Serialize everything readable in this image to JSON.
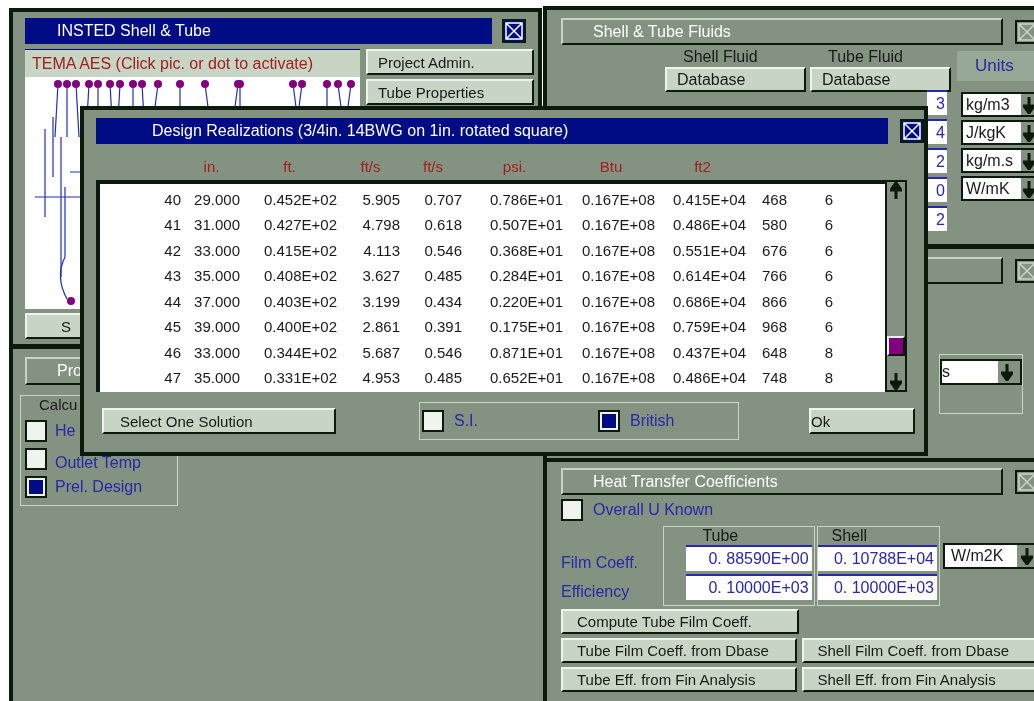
{
  "main_window": {
    "title": "INSTED Shell & Tube",
    "exchanger_label": "TEMA AES (Click pic. or dot to activate)",
    "buttons": [
      "Project Admin.",
      "Tube Properties"
    ],
    "partial_button": "S"
  },
  "calc_window": {
    "partial_button": "Pro",
    "group_label": "Calcu",
    "options": [
      {
        "label": "He",
        "selected": false
      },
      {
        "label": "Outlet Temp",
        "selected": false
      },
      {
        "label": "Prel. Design",
        "selected": true
      }
    ]
  },
  "fluids_window": {
    "title": "Shell & Tube Fluids",
    "fluids": [
      {
        "label": "Shell Fluid",
        "button": "Database"
      },
      {
        "label": "Tube Fluid",
        "button": "Database"
      }
    ],
    "tube_value_fragments": [
      "3",
      "4",
      "2",
      "0",
      "2"
    ],
    "units_label": "Units",
    "units": [
      "kg/m3",
      "J/kgK",
      "kg/m.s",
      "W/mK"
    ]
  },
  "third_window": {
    "field_fragment": "s"
  },
  "heat_window": {
    "title": "Heat Transfer Coefficients",
    "overall_u": {
      "label": "Overall U Known",
      "checked": false
    },
    "groups": [
      "Tube",
      "Shell"
    ],
    "rows": [
      {
        "label": "Film Coeff.",
        "tube": "0. 88590E+00",
        "shell": "0. 10788E+04",
        "unit": "W/m2K"
      },
      {
        "label": "Efficiency",
        "tube": "0. 10000E+03",
        "shell": "0. 10000E+03"
      }
    ],
    "compute_button": "Compute Tube Film Coeff.",
    "button_rows": [
      [
        "Tube Film Coeff. from Dbase",
        "Shell Film Coeff. from Dbase"
      ],
      [
        "Tube Eff. from Fin Analysis",
        "Shell Eff. from Fin Analysis"
      ]
    ]
  },
  "dialog": {
    "title": "Design Realizations (3/4in. 14BWG on 1in. rotated square)",
    "column_units": [
      "in.",
      "ft.",
      "ft/s",
      "ft/s",
      "psi.",
      "Btu",
      "ft2"
    ],
    "rows": [
      [
        "40",
        "29.000",
        "0.452E+02",
        "5.905",
        "0.707",
        "0.786E+01",
        "0.167E+08",
        "0.415E+04",
        "468",
        "6"
      ],
      [
        "41",
        "31.000",
        "0.427E+02",
        "4.798",
        "0.618",
        "0.507E+01",
        "0.167E+08",
        "0.486E+04",
        "580",
        "6"
      ],
      [
        "42",
        "33.000",
        "0.415E+02",
        "4.113",
        "0.546",
        "0.368E+01",
        "0.167E+08",
        "0.551E+04",
        "676",
        "6"
      ],
      [
        "43",
        "35.000",
        "0.408E+02",
        "3.627",
        "0.485",
        "0.284E+01",
        "0.167E+08",
        "0.614E+04",
        "766",
        "6"
      ],
      [
        "44",
        "37.000",
        "0.403E+02",
        "3.199",
        "0.434",
        "0.220E+01",
        "0.167E+08",
        "0.686E+04",
        "866",
        "6"
      ],
      [
        "45",
        "39.000",
        "0.400E+02",
        "2.861",
        "0.391",
        "0.175E+01",
        "0.167E+08",
        "0.759E+04",
        "968",
        "6"
      ],
      [
        "46",
        "33.000",
        "0.344E+02",
        "5.687",
        "0.546",
        "0.871E+01",
        "0.167E+08",
        "0.437E+04",
        "648",
        "8"
      ],
      [
        "47",
        "35.000",
        "0.331E+02",
        "4.953",
        "0.485",
        "0.652E+01",
        "0.167E+08",
        "0.486E+04",
        "748",
        "8"
      ]
    ],
    "select_button": "Select One Solution",
    "unit_systems": [
      {
        "label": "S.I.",
        "selected": false
      },
      {
        "label": "British",
        "selected": true
      }
    ],
    "ok_button": "Ok"
  }
}
